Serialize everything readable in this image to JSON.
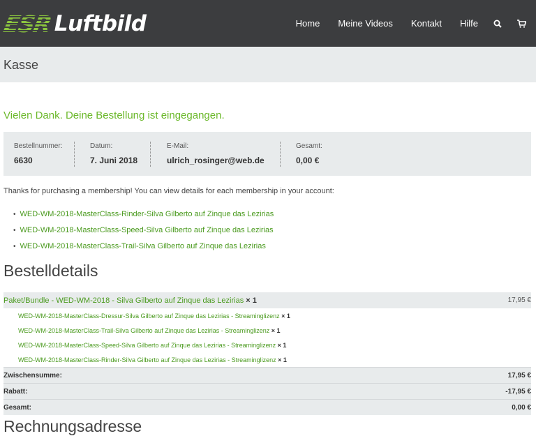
{
  "header": {
    "logo_part1": "ESR",
    "logo_part2": "Luftbild",
    "nav": [
      "Home",
      "Meine Videos",
      "Kontakt",
      "Hilfe"
    ],
    "icons": [
      "search-icon",
      "cart-icon"
    ]
  },
  "page_title": "Kasse",
  "thanks_message": "Vielen Dank. Deine Bestellung ist eingegangen.",
  "overview": {
    "order_number": {
      "label": "Bestellnummer:",
      "value": "6630"
    },
    "date": {
      "label": "Datum:",
      "value": "7. Juni 2018"
    },
    "email": {
      "label": "E-Mail:",
      "value": "ulrich_rosinger@web.de"
    },
    "total": {
      "label": "Gesamt:",
      "value": "0,00 €"
    }
  },
  "membership": {
    "intro": "Thanks for purchasing a membership! You can view details for each membership in your account:",
    "items": [
      "WED-WM-2018-MasterClass-Rinder-Silva Gilberto auf Zinque das Lezirias",
      "WED-WM-2018-MasterClass-Speed-Silva Gilberto auf Zinque das Lezirias",
      "WED-WM-2018-MasterClass-Trail-Silva Gilberto auf Zinque das Lezirias"
    ]
  },
  "order_details": {
    "heading": "Bestelldetails",
    "main_item": {
      "name": "Paket/Bundle - WED-WM-2018 - Silva Gilberto auf Zinque das Lezirias",
      "qty": "× 1",
      "price": "17,95 €"
    },
    "sub_items": [
      {
        "name": "WED-WM-2018-MasterClass-Dressur-Silva Gilberto auf Zinque das Lezirias - Streaminglizenz",
        "qty": "× 1"
      },
      {
        "name": "WED-WM-2018-MasterClass-Trail-Silva Gilberto auf Zinque das Lezirias - Streaminglizenz",
        "qty": "× 1"
      },
      {
        "name": "WED-WM-2018-MasterClass-Speed-Silva Gilberto auf Zinque das Lezirias - Streaminglizenz",
        "qty": "× 1"
      },
      {
        "name": "WED-WM-2018-MasterClass-Rinder-Silva Gilberto auf Zinque das Lezirias - Streaminglizenz",
        "qty": "× 1"
      }
    ],
    "totals": [
      {
        "label": "Zwischensumme:",
        "value": "17,95 €"
      },
      {
        "label": "Rabatt:",
        "value": "-17,95 €"
      },
      {
        "label": "Gesamt:",
        "value": "0,00 €"
      }
    ]
  },
  "billing_heading": "Rechnungsadresse",
  "colors": {
    "accent": "#6bb82a",
    "header_bg": "#3c3d3f",
    "panel_bg": "#e8ebec"
  }
}
